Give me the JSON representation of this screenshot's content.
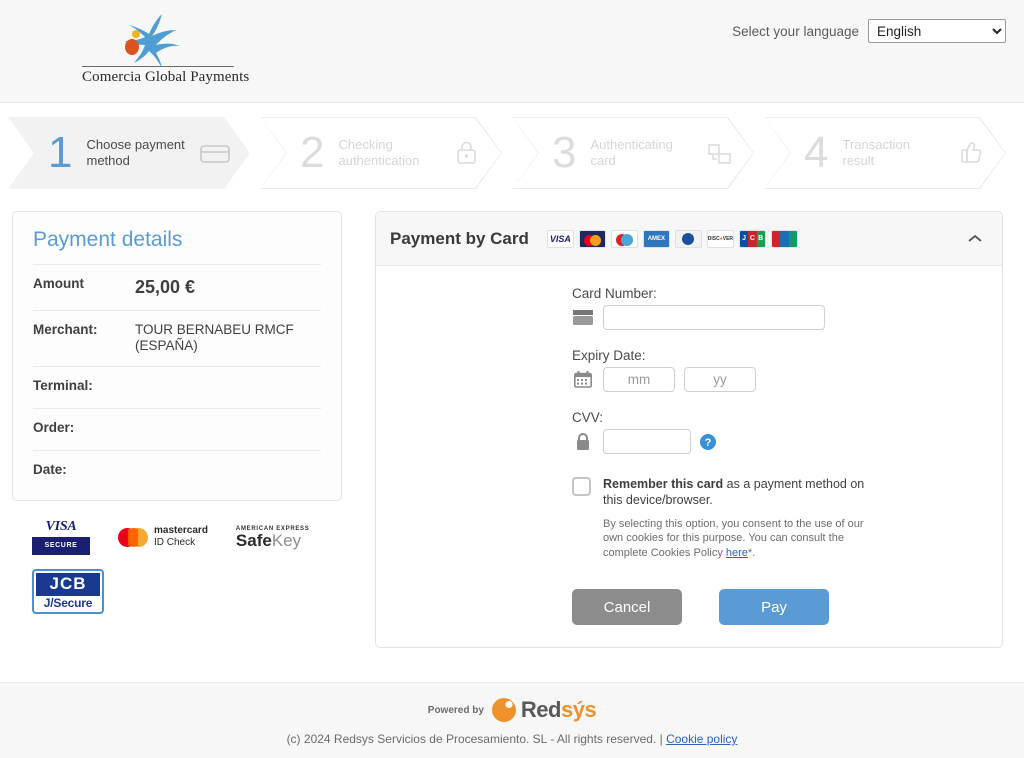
{
  "header": {
    "logo_text": "Comercia Global Payments",
    "logo_icon": "caixabank-star-icon",
    "language_label": "Select your language",
    "language_value": "English",
    "language_options": [
      "English"
    ]
  },
  "stepper": {
    "steps": [
      {
        "number": "1",
        "line1": "Choose payment",
        "line2": "method",
        "icon": "credit-card-icon",
        "state": "active"
      },
      {
        "number": "2",
        "line1": "Checking",
        "line2": "authentication",
        "icon": "lock-icon",
        "state": "idle"
      },
      {
        "number": "3",
        "line1": "Authenticating",
        "line2": "card",
        "icon": "devices-icon",
        "state": "idle"
      },
      {
        "number": "4",
        "line1": "Transaction",
        "line2": "result",
        "icon": "thumbs-up-icon",
        "state": "idle"
      }
    ]
  },
  "payment_details": {
    "title": "Payment details",
    "rows": [
      {
        "key": "Amount",
        "value": "25,00 €"
      },
      {
        "key": "Merchant:",
        "value": "TOUR BERNABEU RMCF (ESPAÑA)"
      },
      {
        "key": "Terminal:",
        "value": ""
      },
      {
        "key": "Order:",
        "value": ""
      },
      {
        "key": "Date:",
        "value": ""
      }
    ]
  },
  "security_badges": [
    {
      "name": "visa-secure-badge",
      "top": "VISA",
      "bottom": "SECURE"
    },
    {
      "name": "mastercard-idcheck-badge",
      "line1": "mastercard",
      "line2": "ID Check"
    },
    {
      "name": "amex-safekey-badge",
      "top": "AMERICAN EXPRESS",
      "main": "Safe",
      "main_light": "Key"
    },
    {
      "name": "jcb-jsecure-badge",
      "top": "JCB",
      "bottom": "J/Secure"
    }
  ],
  "pay_panel": {
    "title": "Payment by Card",
    "collapse_icon": "chevron-up-icon",
    "brands": [
      {
        "name": "visa-brand-icon",
        "label": "VISA"
      },
      {
        "name": "mastercard-brand-icon",
        "label": ""
      },
      {
        "name": "maestro-brand-icon",
        "label": ""
      },
      {
        "name": "amex-brand-icon",
        "label": ""
      },
      {
        "name": "diners-brand-icon",
        "label": ""
      },
      {
        "name": "discover-brand-icon",
        "label": "DISC VER"
      },
      {
        "name": "jcb-brand-icon",
        "label": "JCB"
      },
      {
        "name": "unionpay-brand-icon",
        "label": ""
      }
    ],
    "fields": {
      "card_number_label": "Card Number:",
      "card_number_value": "",
      "card_number_placeholder": "",
      "card_number_icon": "credit-card-icon",
      "expiry_label": "Expiry Date:",
      "expiry_icon": "calendar-icon",
      "expiry_month_value": "",
      "expiry_month_placeholder": "mm",
      "expiry_year_value": "",
      "expiry_year_placeholder": "yy",
      "cvv_label": "CVV:",
      "cvv_icon": "lock-icon",
      "cvv_value": "",
      "cvv_placeholder": "",
      "cvv_help_icon": "question-mark-icon"
    },
    "remember": {
      "checked": false,
      "bold_text": "Remember this card",
      "rest_text": " as a payment method on this device/browser.",
      "consent_text": "By selecting this option, you consent to the use of our own cookies for this purpose. You can consult the complete Cookies Policy ",
      "consent_link": "here",
      "consent_tail": "*."
    },
    "buttons": {
      "cancel": "Cancel",
      "pay": "Pay"
    }
  },
  "footer": {
    "powered_label": "Powered by",
    "brand_a": "Red",
    "brand_b": "sýs",
    "copyright": "(c) 2024 Redsys Servicios de Procesamiento. SL - All rights reserved. | ",
    "cookie_link": "Cookie policy"
  },
  "colors": {
    "accent_blue": "#5b9bd5",
    "link_blue": "#2a63c4",
    "cancel_gray": "#8c8c8c",
    "header_bg": "#f7f7f7",
    "redsys_orange": "#f0922b"
  }
}
